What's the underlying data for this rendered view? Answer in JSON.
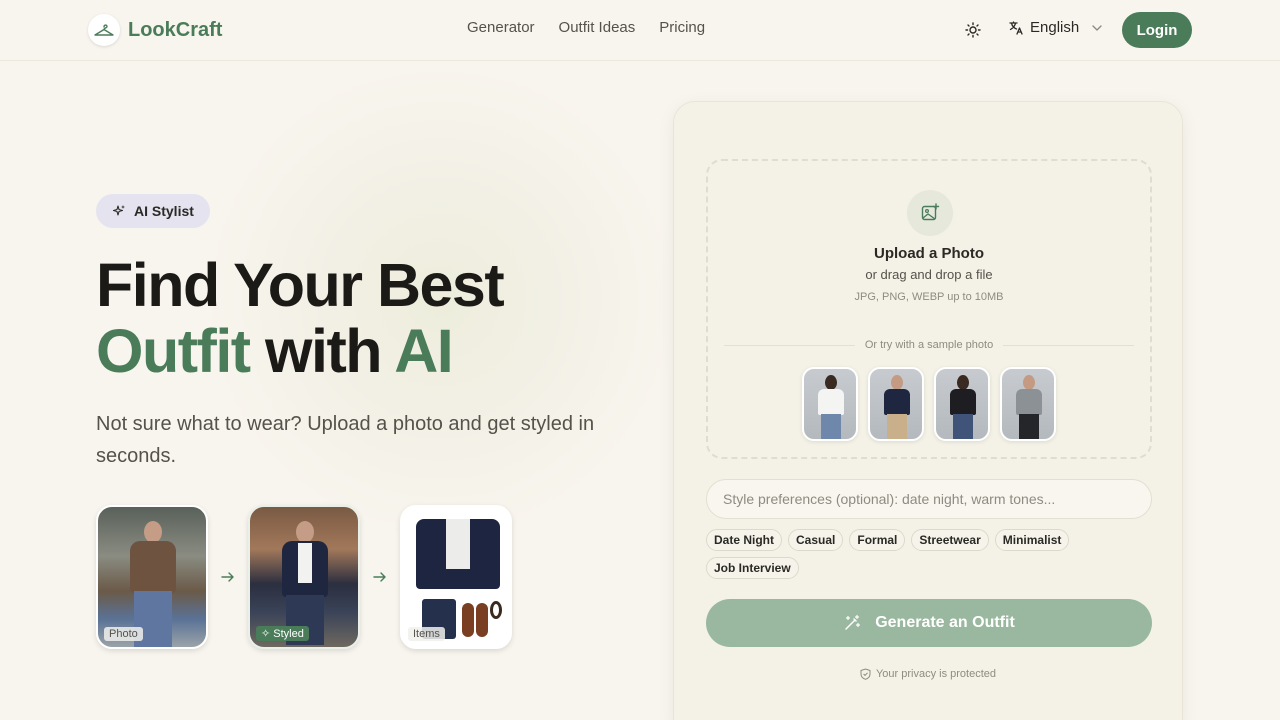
{
  "brand": {
    "name": "LookCraft",
    "accent": "#4a7c59"
  },
  "nav": {
    "items": [
      {
        "label": "Generator"
      },
      {
        "label": "Outfit Ideas"
      },
      {
        "label": "Pricing"
      }
    ]
  },
  "header": {
    "theme_icon": "sun-icon",
    "language": "English",
    "login_label": "Login"
  },
  "hero": {
    "badge": "AI Stylist",
    "headline": {
      "line1": "Find Your Best",
      "word_outfit": "Outfit",
      "word_with": " with ",
      "word_ai": "AI"
    },
    "subtitle": "Not sure what to wear? Upload a photo and get styled in seconds.",
    "steps": [
      {
        "label": "Photo"
      },
      {
        "label": "Styled"
      },
      {
        "label": "Items"
      }
    ]
  },
  "upload": {
    "title": "Upload a Photo",
    "subtitle": "or drag and drop a file",
    "hint": "JPG, PNG, WEBP up to 10MB",
    "sample_divider": "Or try with a sample photo",
    "samples": [
      {
        "icon": "sample-woman-white-top"
      },
      {
        "icon": "sample-man-navy-sweater"
      },
      {
        "icon": "sample-woman-black-top"
      },
      {
        "icon": "sample-man-grey-tee"
      }
    ]
  },
  "preferences": {
    "placeholder": "Style preferences (optional): date night, warm tones...",
    "value": "",
    "chips": [
      {
        "label": "Date Night"
      },
      {
        "label": "Casual"
      },
      {
        "label": "Formal"
      },
      {
        "label": "Streetwear"
      },
      {
        "label": "Minimalist"
      },
      {
        "label": "Job Interview"
      }
    ]
  },
  "generate": {
    "label": "Generate an Outfit",
    "color": "#99b89f"
  },
  "privacy": "Your privacy is protected"
}
